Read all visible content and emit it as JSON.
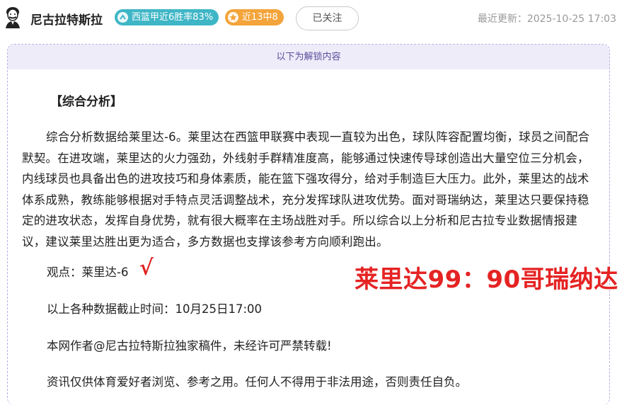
{
  "header": {
    "author_name": "尼古拉特斯拉",
    "badge_streak": "西篮甲近6胜率83%",
    "badge_recent": "近13中8",
    "follow_label": "已关注",
    "last_update": "最近更新：2025-10-25 17:03",
    "avatar_icon": "tesla-portrait-avatar",
    "colors": {
      "teal": "#3fb6c6",
      "orange": "#f3a43a"
    }
  },
  "card": {
    "unlock_notice": "以下为解锁内容",
    "section_title": "【综合分析】",
    "analysis": "综合分析数据给莱里达-6。莱里达在西篮甲联赛中表现一直较为出色，球队阵容配置均衡，球员之间配合默契。在进攻端，莱里达的火力强劲，外线射手群精准度高，能够通过快速传导球创造出大量空位三分机会，内线球员也具备出色的进攻技巧和身体素质，能在篮下强攻得分，给对手制造巨大压力。此外，莱里达的战术体系成熟，教练能够根据对手特点灵活调整战术，充分发挥球队进攻优势。面对哥瑞纳达，莱里达只要保持稳定的进攻状态，发挥自身优势，就有很大概率在主场战胜对手。所以综合以上分析和尼古拉专业数据情报建议，建议莱里达胜出更为适合，多方数据也支撑该参考方向顺利跑出。",
    "view": "观点：莱里达-6",
    "check_mark": "√",
    "final_score": "莱里达99：90哥瑞纳达",
    "deadline": "以上各种数据截止时间：10月25日17:00",
    "copyright": "本网作者@尼古拉特斯拉独家稿件，未经许可严禁转载!",
    "disclaimer": "资讯仅供体育爱好者浏览、参考之用。任何人不得用于非法用途，否则责任自负。"
  }
}
